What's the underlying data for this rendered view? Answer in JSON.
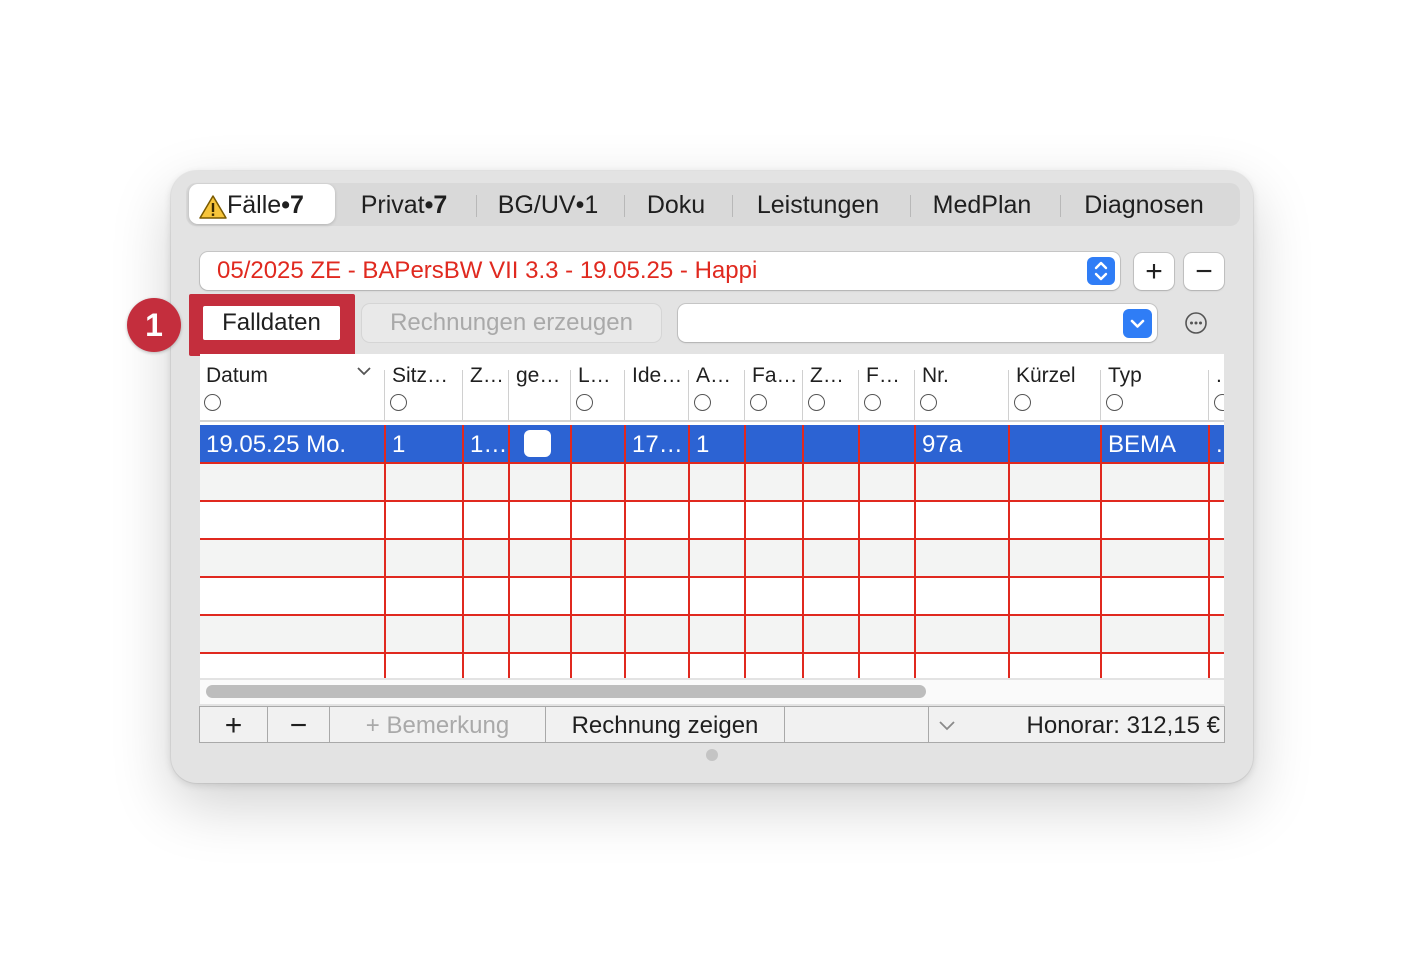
{
  "tabs": [
    {
      "label": "Fälle",
      "count": "•7",
      "selected": true,
      "warning_icon": "warning-icon"
    },
    {
      "label": "Privat",
      "count": "•7"
    },
    {
      "label": "BG/UV",
      "count": "•1"
    },
    {
      "label": "Doku"
    },
    {
      "label": "Leistungen"
    },
    {
      "label": "MedPlan"
    },
    {
      "label": "Diagnosen"
    }
  ],
  "case_selector": {
    "value": "05/2025 ZE - BAPersBW VII 3.3 - 19.05.25 - Happi",
    "color": "#e0291f"
  },
  "case_buttons": {
    "add": "+",
    "remove": "−"
  },
  "toolbar": {
    "step_badge": "1",
    "falldaten_label": "Falldaten",
    "rechnungen_label": "Rechnungen erzeugen",
    "popup_value": ""
  },
  "table": {
    "columns": [
      {
        "label": "Datum"
      },
      {
        "label": "Sitz…"
      },
      {
        "label": "Z…"
      },
      {
        "label": "ge…"
      },
      {
        "label": "L…"
      },
      {
        "label": "Ide…"
      },
      {
        "label": "A…"
      },
      {
        "label": "Fa…"
      },
      {
        "label": "Z…"
      },
      {
        "label": "F…"
      },
      {
        "label": "Nr."
      },
      {
        "label": "Kürzel"
      },
      {
        "label": "Typ"
      },
      {
        "label": "."
      }
    ],
    "selected_row": {
      "datum": "19.05.25  Mo.",
      "sitz": "1",
      "z": "1…",
      "l": "",
      "ide": "17…",
      "a": "1",
      "nr": "97a",
      "typ": "BEMA",
      "extra": "."
    },
    "selection_color": "#2c63d3",
    "grid_color": "#e0291f"
  },
  "bottom_bar": {
    "add": "+",
    "remove": "−",
    "bemerkung": "+ Bemerkung",
    "rechnung_zeigen": "Rechnung zeigen",
    "honorar": "Honorar: 312,15 €"
  },
  "colors": {
    "accent": "#2f7df6",
    "highlight": "#c42e3d"
  }
}
